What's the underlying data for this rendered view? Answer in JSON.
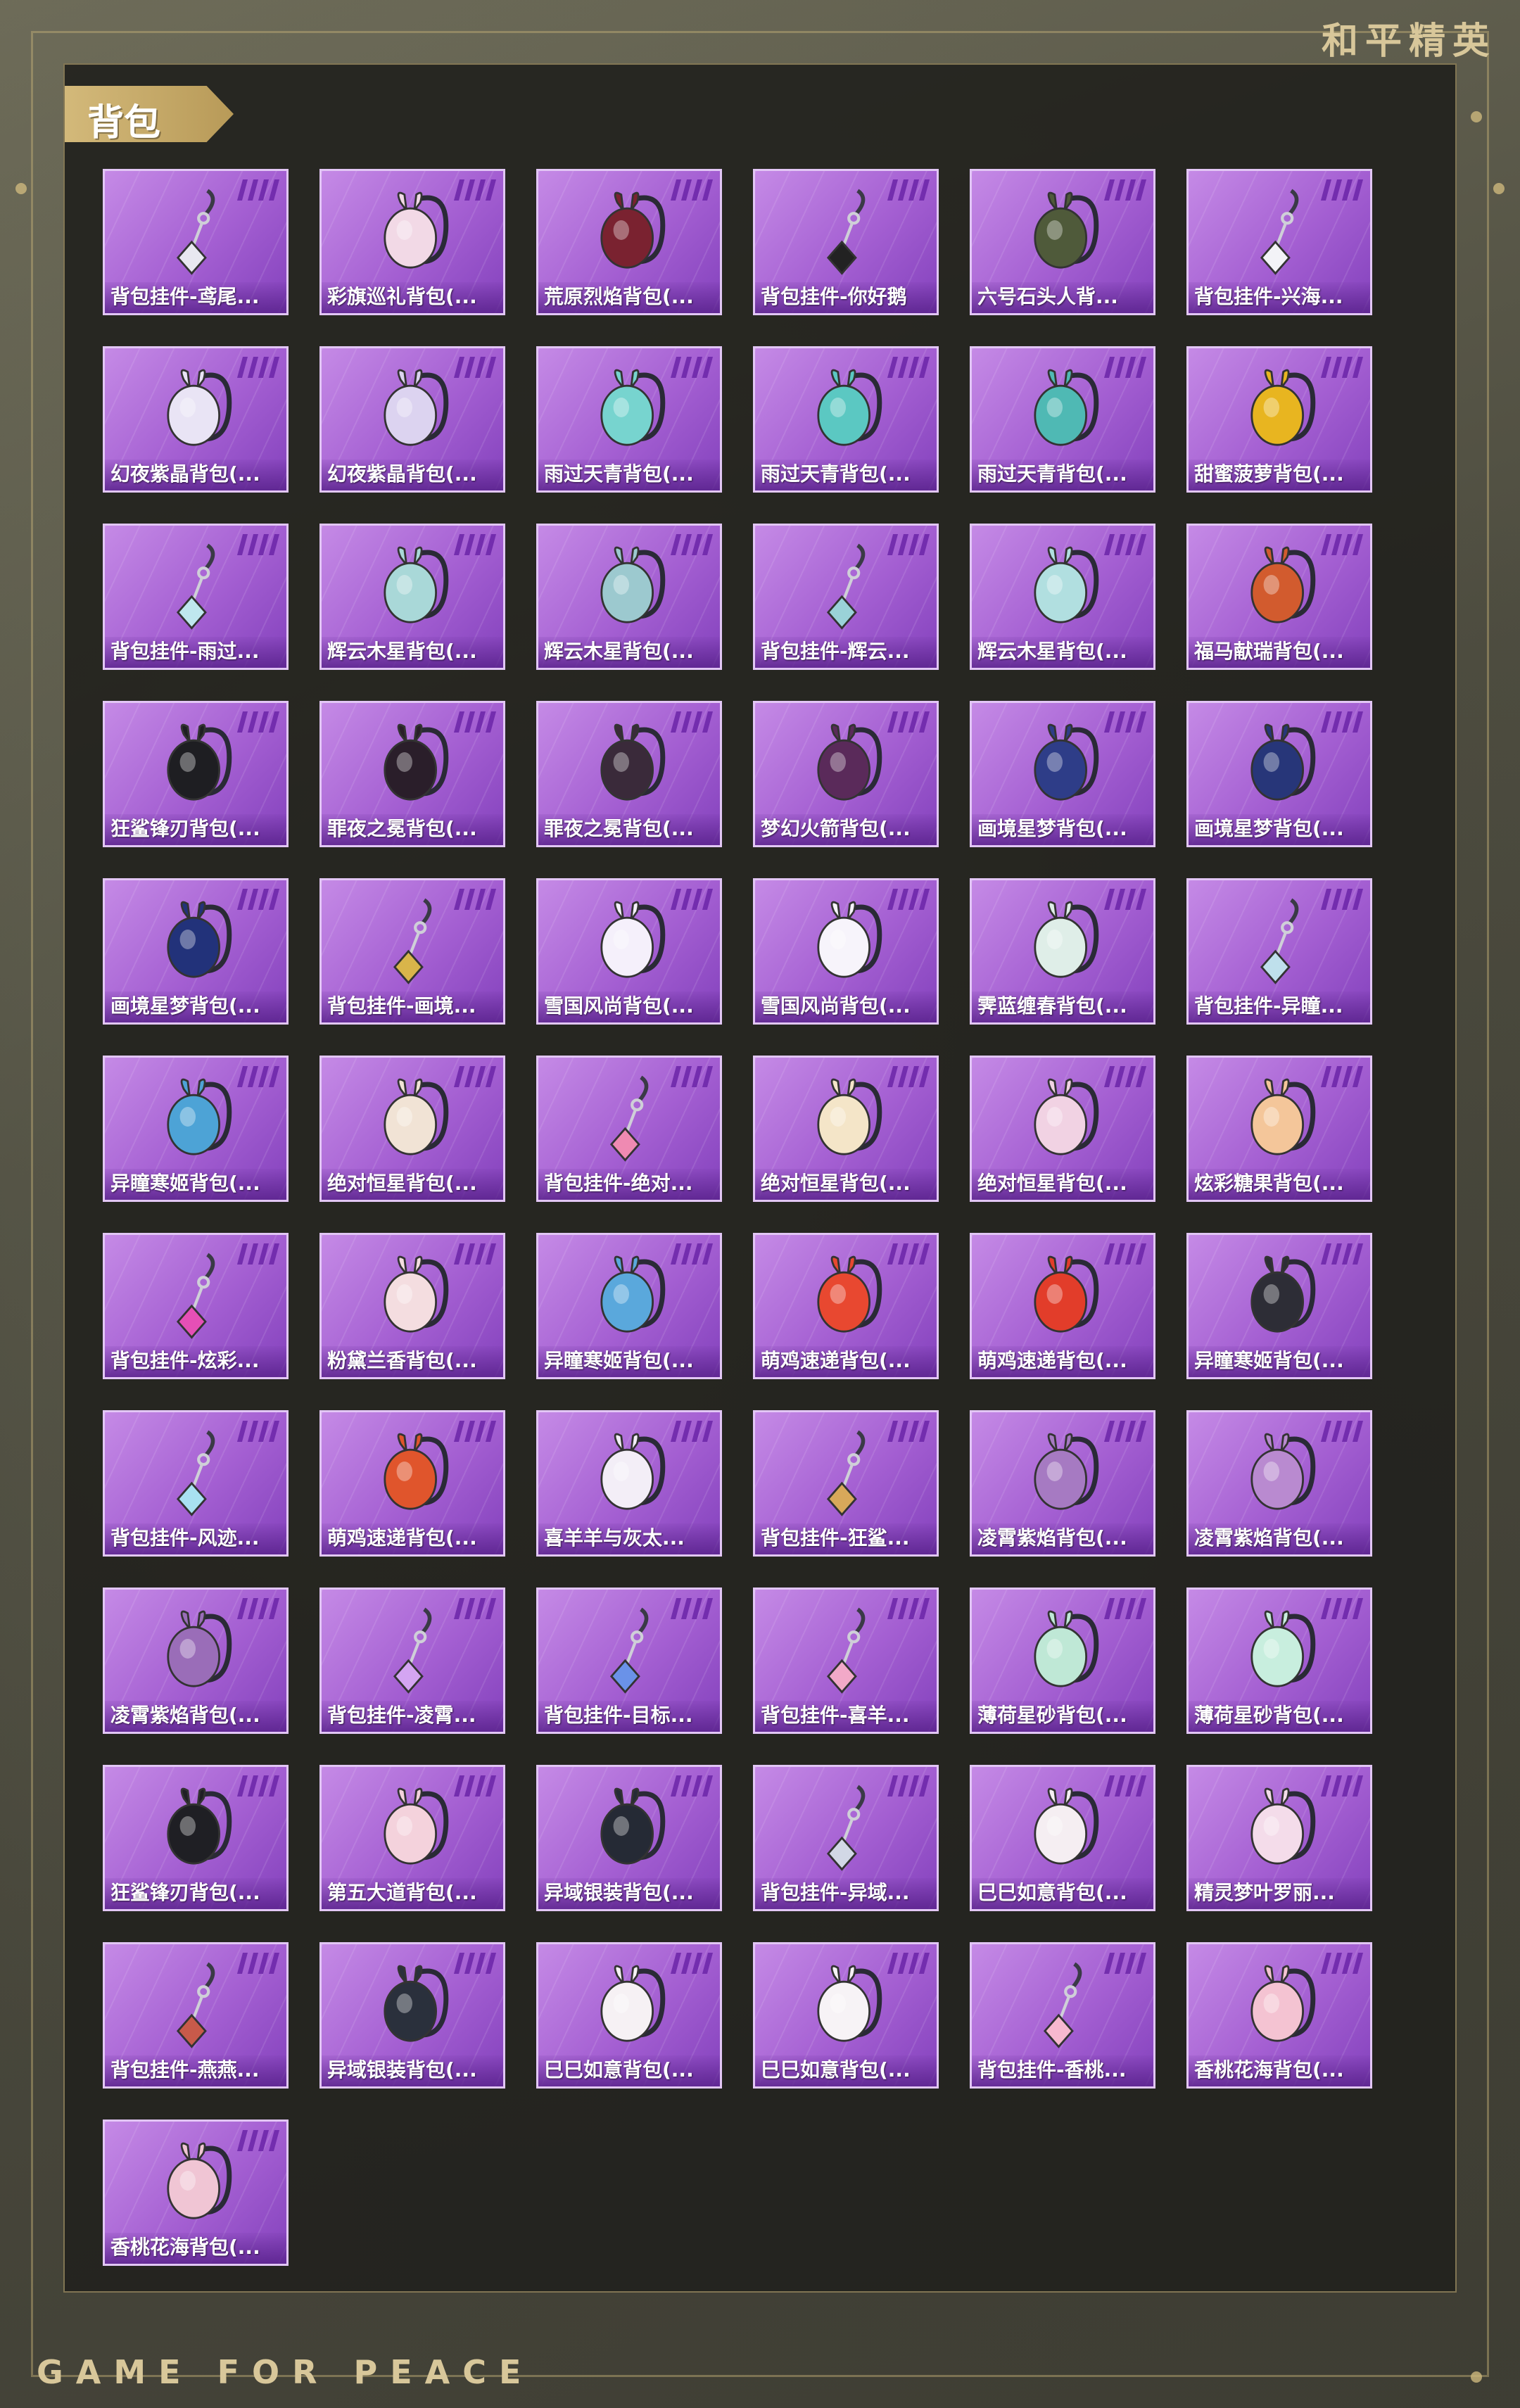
{
  "header": {
    "logo": "和平精英"
  },
  "footer": {
    "slogan": "GAME FOR PEACE"
  },
  "section": {
    "title": "背包"
  },
  "colors": {
    "card_primary": "#a45fd2",
    "card_border": "#e2c6f5",
    "tag_gold": "#d3b97a",
    "panel_bg": "#22221e"
  },
  "items": [
    {
      "name": "背包挂件-鸢尾...",
      "icon": "pendant-icon",
      "color": "#e8e8f0"
    },
    {
      "name": "彩旗巡礼背包(...",
      "icon": "backpack-icon",
      "color": "#f2d9e6"
    },
    {
      "name": "荒原烈焰背包(...",
      "icon": "backpack-icon",
      "color": "#7a2230"
    },
    {
      "name": "背包挂件-你好鹅",
      "icon": "pendant-icon",
      "color": "#222222"
    },
    {
      "name": "六号石头人背...",
      "icon": "backpack-icon",
      "color": "#4f5a3a"
    },
    {
      "name": "背包挂件-兴海...",
      "icon": "pendant-icon",
      "color": "#f3f3f7"
    },
    {
      "name": "幻夜紫晶背包(...",
      "icon": "backpack-icon",
      "color": "#e9e4f5"
    },
    {
      "name": "幻夜紫晶背包(...",
      "icon": "backpack-icon",
      "color": "#dcd3f0"
    },
    {
      "name": "雨过天青背包(...",
      "icon": "backpack-icon",
      "color": "#77d4cf"
    },
    {
      "name": "雨过天青背包(...",
      "icon": "backpack-icon",
      "color": "#5bc8c2"
    },
    {
      "name": "雨过天青背包(...",
      "icon": "backpack-icon",
      "color": "#4fb9b4"
    },
    {
      "name": "甜蜜菠萝背包(...",
      "icon": "backpack-icon",
      "color": "#e8b520"
    },
    {
      "name": "背包挂件-雨过...",
      "icon": "pendant-icon",
      "color": "#bfe7ee"
    },
    {
      "name": "辉云木星背包(...",
      "icon": "backpack-icon",
      "color": "#a9d8d8"
    },
    {
      "name": "辉云木星背包(...",
      "icon": "backpack-icon",
      "color": "#9cc9cf"
    },
    {
      "name": "背包挂件-辉云...",
      "icon": "pendant-icon",
      "color": "#9ad2d8"
    },
    {
      "name": "辉云木星背包(...",
      "icon": "backpack-icon",
      "color": "#b1dfe0"
    },
    {
      "name": "福马献瑞背包(...",
      "icon": "backpack-icon",
      "color": "#d25b2e"
    },
    {
      "name": "狂鲨锋刃背包(...",
      "icon": "backpack-icon",
      "color": "#1e1e22"
    },
    {
      "name": "罪夜之冕背包(...",
      "icon": "backpack-icon",
      "color": "#2a1e2a"
    },
    {
      "name": "罪夜之冕背包(...",
      "icon": "backpack-icon",
      "color": "#3a2a3a"
    },
    {
      "name": "梦幻火箭背包(...",
      "icon": "backpack-icon",
      "color": "#5a2a5a"
    },
    {
      "name": "画境星梦背包(...",
      "icon": "backpack-icon",
      "color": "#2e3d88"
    },
    {
      "name": "画境星梦背包(...",
      "icon": "backpack-icon",
      "color": "#273679"
    },
    {
      "name": "画境星梦背包(...",
      "icon": "backpack-icon",
      "color": "#22327a"
    },
    {
      "name": "背包挂件-画境...",
      "icon": "pendant-icon",
      "color": "#d9b54a"
    },
    {
      "name": "雪国风尚背包(...",
      "icon": "backpack-icon",
      "color": "#f5f0fb"
    },
    {
      "name": "雪国风尚背包(...",
      "icon": "backpack-icon",
      "color": "#f7f4fb"
    },
    {
      "name": "霁蓝缠春背包(...",
      "icon": "backpack-icon",
      "color": "#dfeee8"
    },
    {
      "name": "背包挂件-异瞳...",
      "icon": "pendant-icon",
      "color": "#bfe0ec"
    },
    {
      "name": "异瞳寒姬背包(...",
      "icon": "backpack-icon",
      "color": "#4da3d6"
    },
    {
      "name": "绝对恒星背包(...",
      "icon": "backpack-icon",
      "color": "#f1e3d5"
    },
    {
      "name": "背包挂件-绝对...",
      "icon": "pendant-icon",
      "color": "#ef8ab2"
    },
    {
      "name": "绝对恒星背包(...",
      "icon": "backpack-icon",
      "color": "#f4e5c8"
    },
    {
      "name": "绝对恒星背包(...",
      "icon": "backpack-icon",
      "color": "#f1d2e3"
    },
    {
      "name": "炫彩糖果背包(...",
      "icon": "backpack-icon",
      "color": "#f4c69a"
    },
    {
      "name": "背包挂件-炫彩...",
      "icon": "pendant-icon",
      "color": "#e64fb6"
    },
    {
      "name": "粉黛兰香背包(...",
      "icon": "backpack-icon",
      "color": "#f4dde0"
    },
    {
      "name": "异瞳寒姬背包(...",
      "icon": "backpack-icon",
      "color": "#5aa8dc"
    },
    {
      "name": "萌鸡速递背包(...",
      "icon": "backpack-icon",
      "color": "#e84830"
    },
    {
      "name": "萌鸡速递背包(...",
      "icon": "backpack-icon",
      "color": "#e23d2a"
    },
    {
      "name": "异瞳寒姬背包(...",
      "icon": "backpack-icon",
      "color": "#2d2d36"
    },
    {
      "name": "背包挂件-风迹...",
      "icon": "pendant-icon",
      "color": "#a8e1f1"
    },
    {
      "name": "萌鸡速递背包(...",
      "icon": "backpack-icon",
      "color": "#e0552c"
    },
    {
      "name": "喜羊羊与灰太...",
      "icon": "backpack-icon",
      "color": "#f3eef7"
    },
    {
      "name": "背包挂件-狂鲨...",
      "icon": "pendant-icon",
      "color": "#d8a85a"
    },
    {
      "name": "凌霄紫焰背包(...",
      "icon": "backpack-icon",
      "color": "#a67ac2"
    },
    {
      "name": "凌霄紫焰背包(...",
      "icon": "backpack-icon",
      "color": "#b98ad0"
    },
    {
      "name": "凌霄紫焰背包(...",
      "icon": "backpack-icon",
      "color": "#9a6db8"
    },
    {
      "name": "背包挂件-凌霄...",
      "icon": "pendant-icon",
      "color": "#d4a5f2"
    },
    {
      "name": "背包挂件-目标...",
      "icon": "pendant-icon",
      "color": "#6a92e8"
    },
    {
      "name": "背包挂件-喜羊...",
      "icon": "pendant-icon",
      "color": "#f2a9c8"
    },
    {
      "name": "薄荷星砂背包(...",
      "icon": "backpack-icon",
      "color": "#bfe8d6"
    },
    {
      "name": "薄荷星砂背包(...",
      "icon": "backpack-icon",
      "color": "#c8eede"
    },
    {
      "name": "狂鲨锋刃背包(...",
      "icon": "backpack-icon",
      "color": "#1f1f24"
    },
    {
      "name": "第五大道背包(...",
      "icon": "backpack-icon",
      "color": "#f4d2dc"
    },
    {
      "name": "异域银装背包(...",
      "icon": "backpack-icon",
      "color": "#252a35"
    },
    {
      "name": "背包挂件-异域...",
      "icon": "pendant-icon",
      "color": "#d2d8e6"
    },
    {
      "name": "巳巳如意背包(...",
      "icon": "backpack-icon",
      "color": "#f5eef2"
    },
    {
      "name": "精灵梦叶罗丽...",
      "icon": "backpack-icon",
      "color": "#f4dcea"
    },
    {
      "name": "背包挂件-燕燕...",
      "icon": "pendant-icon",
      "color": "#c85a4a"
    },
    {
      "name": "异域银装背包(...",
      "icon": "backpack-icon",
      "color": "#2a303c"
    },
    {
      "name": "巳巳如意背包(...",
      "icon": "backpack-icon",
      "color": "#f6f1f4"
    },
    {
      "name": "巳巳如意背包(...",
      "icon": "backpack-icon",
      "color": "#f7f3f6"
    },
    {
      "name": "背包挂件-香桃...",
      "icon": "pendant-icon",
      "color": "#f7b8cf"
    },
    {
      "name": "香桃花海背包(...",
      "icon": "backpack-icon",
      "color": "#f4c3d2"
    },
    {
      "name": "香桃花海背包(...",
      "icon": "backpack-icon",
      "color": "#f0c5d4"
    }
  ]
}
